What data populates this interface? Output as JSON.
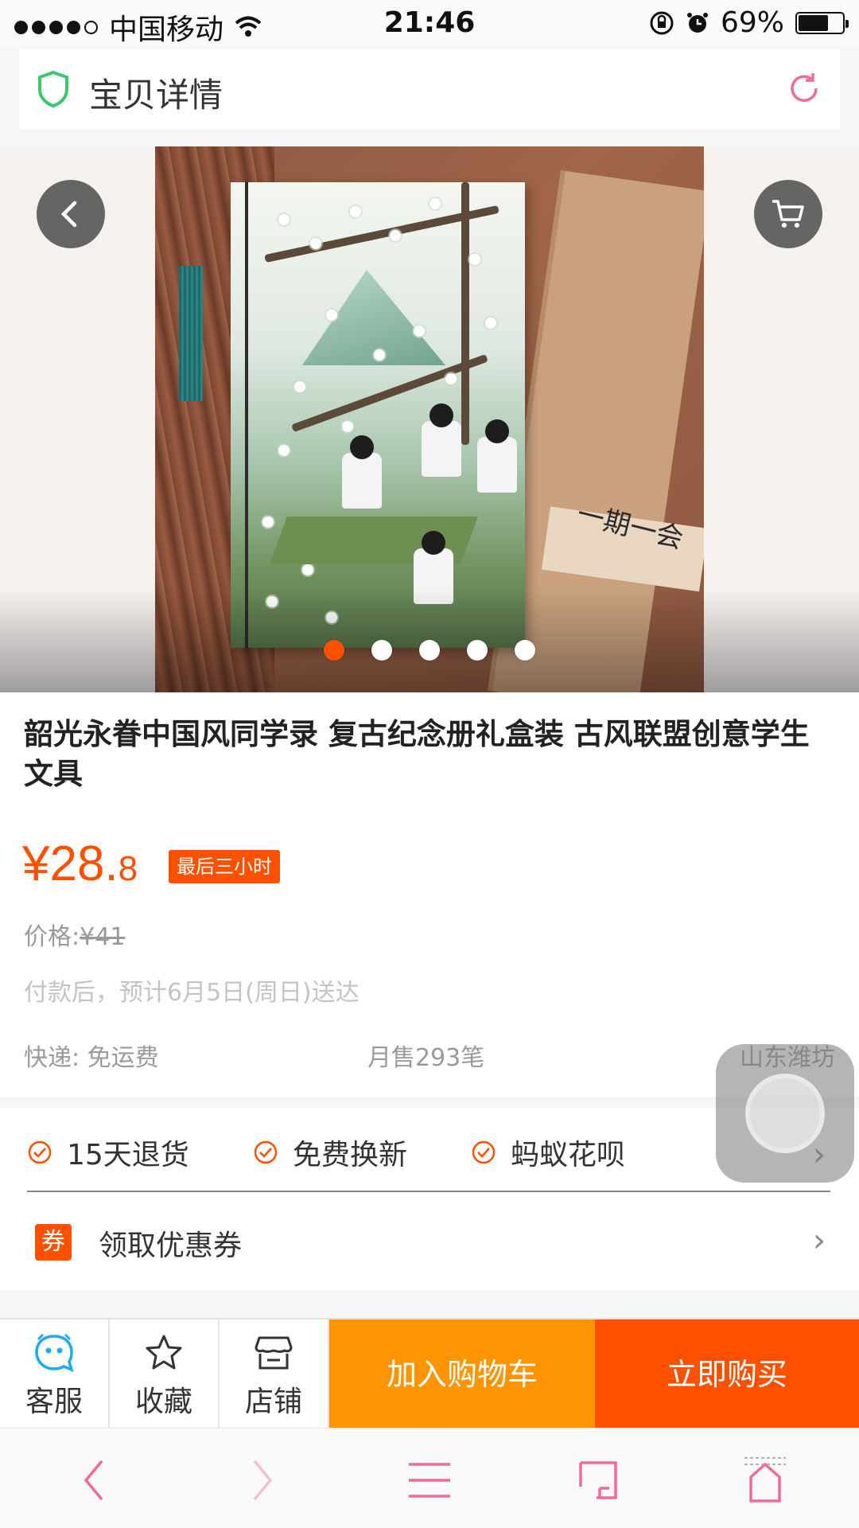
{
  "status_bar": {
    "carrier": "中国移动",
    "time": "21:46",
    "battery_percent": "69%",
    "battery_level": 0.69
  },
  "header": {
    "title": "宝贝详情",
    "icons": [
      "shield-icon",
      "refresh-icon"
    ]
  },
  "hero": {
    "box_text": "一期一会",
    "page_count": 5,
    "active_page": 1
  },
  "product": {
    "title": "韶光永眷中国风同学录 复古纪念册礼盒装 古风联盟创意学生文具",
    "price_main": "¥28.",
    "price_decimal": "8",
    "promo_badge": "最后三小时",
    "original_price_label": "价格:",
    "original_price_value": "¥41",
    "delivery_estimate": "付款后，预计6月5日(周日)送达",
    "shipping": "快递: 免运费",
    "monthly_sales": "月售293笔",
    "location": "山东潍坊"
  },
  "services": {
    "items": [
      "15天退货",
      "免费换新",
      "蚂蚁花呗"
    ],
    "coupon_badge": "券",
    "coupon_label": "领取优惠券"
  },
  "action_bar": {
    "customer_service": "客服",
    "favorite": "收藏",
    "shop": "店铺",
    "add_to_cart": "加入购物车",
    "buy_now": "立即购买"
  },
  "colors": {
    "accent": "#ff5000",
    "cart_orange": "#ff9402",
    "browser_pink": "#f06a96"
  }
}
